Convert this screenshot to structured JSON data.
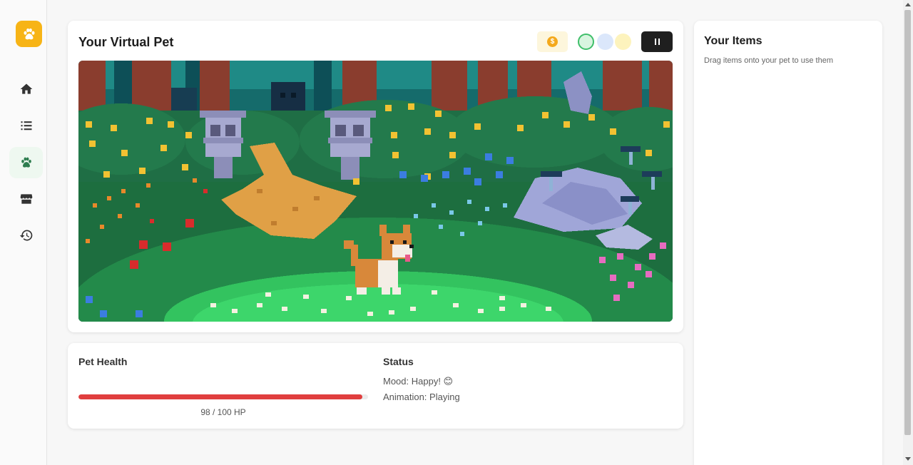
{
  "sidebar": {
    "logo_icon": "paw-icon",
    "items": [
      {
        "icon": "home-icon",
        "active": false
      },
      {
        "icon": "list-icon",
        "active": false
      },
      {
        "icon": "paw-icon",
        "active": true
      },
      {
        "icon": "store-icon",
        "active": false
      },
      {
        "icon": "history-icon",
        "active": false
      }
    ]
  },
  "pet": {
    "title": "Your Virtual Pet",
    "coin_symbol": "$",
    "swatches": [
      "#d8f5df",
      "#dbe7fb",
      "#fdf3bd"
    ],
    "scene": "forest-meadow-corgi"
  },
  "health": {
    "title": "Pet Health",
    "current": 98,
    "max": 100,
    "hp_text": "98 / 100 HP",
    "bar_color": "#e03e3e"
  },
  "status": {
    "title": "Status",
    "mood": "Mood: Happy! 😊",
    "animation": "Animation: Playing"
  },
  "items": {
    "title": "Your Items",
    "description": "Drag items onto your pet to use them"
  },
  "colors": {
    "accent": "#f7b416",
    "active_nav": "#2e7d4f"
  }
}
